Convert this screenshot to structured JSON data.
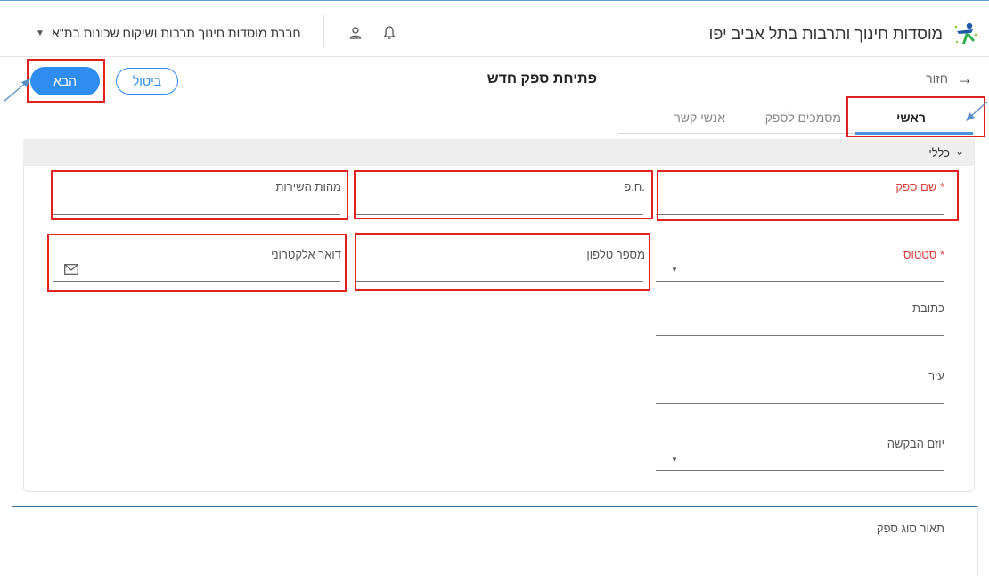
{
  "app": {
    "title": "מוסדות חינוך ותרבות בתל אביב יפו",
    "org_select": "חברת מוסדות חינוך תרבות ושיקום שכונות בת\"א"
  },
  "header": {
    "back_label": "חזור",
    "page_title": "פתיחת ספק חדש",
    "next_label": "הבא",
    "cancel_label": "ביטול"
  },
  "tabs": [
    {
      "label": "ראשי"
    },
    {
      "label": "מסמכים לספק"
    },
    {
      "label": "אנשי קשר"
    }
  ],
  "section": {
    "title": "כללי"
  },
  "fields": {
    "supplier_name": "שם ספק *",
    "company_id": "ח.פ.",
    "service_nature": "מהות השירות",
    "status": "סטטוס *",
    "phone": "מספר טלפון",
    "email": "דואר אלקטרוני",
    "address": "כתובת",
    "city": "עיר",
    "initiator": "יוזם הבקשה"
  },
  "second_section": {
    "supplier_type_desc": "תאור סוג ספק"
  },
  "colors": {
    "accent": "#2f8cf0",
    "required": "#e04040",
    "annotation": "#e02020"
  }
}
